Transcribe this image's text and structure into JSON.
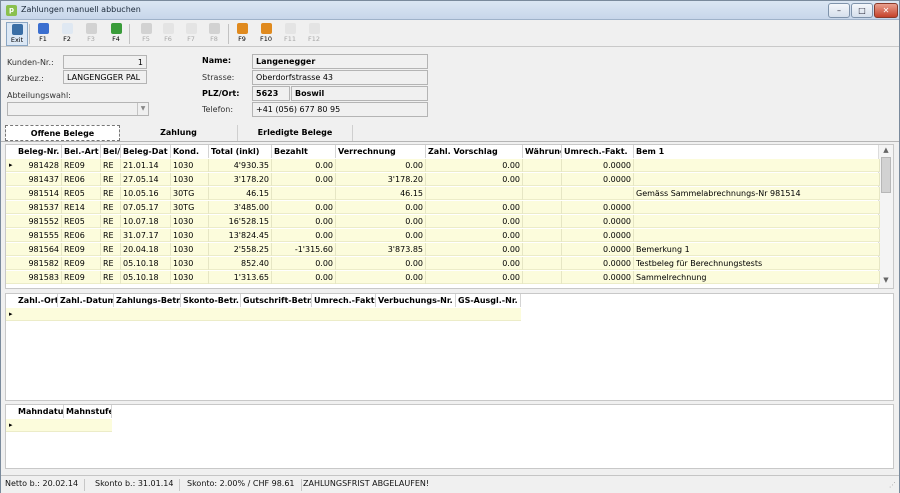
{
  "window": {
    "title": "Zahlungen manuell abbuchen",
    "icon": "app-icon"
  },
  "window_controls": {
    "minimize": "–",
    "maximize": "□",
    "close": "✕"
  },
  "toolbar": [
    {
      "label": "Exit",
      "icon": "exit-icon",
      "color": "#3a6ea5",
      "enabled": true
    },
    {
      "label": "F1",
      "icon": "help-icon",
      "color": "#3b6fd0",
      "enabled": true
    },
    {
      "label": "F2",
      "icon": "new-doc-icon",
      "color": "#dfe8f2",
      "enabled": true
    },
    {
      "label": "F3",
      "icon": "delete-icon",
      "color": "#9a9a9a",
      "enabled": false
    },
    {
      "label": "F4",
      "icon": "flag-icon",
      "color": "#3a9c3a",
      "enabled": true
    },
    {
      "label": "F5",
      "icon": "pin-icon",
      "color": "#9a9a9a",
      "enabled": false
    },
    {
      "label": "F6",
      "icon": "blank-icon",
      "color": "#cfcfcf",
      "enabled": false
    },
    {
      "label": "F7",
      "icon": "blank-icon",
      "color": "#cfcfcf",
      "enabled": false
    },
    {
      "label": "F8",
      "icon": "print-icon",
      "color": "#9a9a9a",
      "enabled": false
    },
    {
      "label": "F9",
      "icon": "wand-icon",
      "color": "#e08a1e",
      "enabled": true
    },
    {
      "label": "F10",
      "icon": "wand-icon",
      "color": "#e08a1e",
      "enabled": true
    },
    {
      "label": "F11",
      "icon": "blank-icon",
      "color": "#cfcfcf",
      "enabled": false
    },
    {
      "label": "F12",
      "icon": "blank-icon",
      "color": "#cfcfcf",
      "enabled": false
    }
  ],
  "customer": {
    "kunden_nr_label": "Kunden-Nr.:",
    "kunden_nr": "1",
    "kurzbez_label": "Kurzbez.:",
    "kurzbez": "LANGENGGER PAL",
    "abteilung_label": "Abteilungswahl:",
    "abteilung": "",
    "name_label": "Name:",
    "name": "Langenegger",
    "strasse_label": "Strasse:",
    "strasse": "Oberdorfstrasse 43",
    "plz_label": "PLZ/Ort:",
    "plz": "5623",
    "ort": "Boswil",
    "telefon_label": "Telefon:",
    "telefon": "+41 (056) 677 80 95"
  },
  "tabs": [
    "Offene Belege",
    "Zahlung",
    "Erledigte Belege"
  ],
  "belege": {
    "columns": [
      "Beleg-Nr.",
      "Bel.-Art",
      "Bel/",
      "Beleg-Dat",
      "Kond.",
      "Total (inkl)",
      "Bezahlt",
      "Verrechnung",
      "Zahl. Vorschlag",
      "Währung",
      "Umrech.-Fakt.",
      "Bem 1"
    ],
    "rows": [
      [
        "981428",
        "RE09",
        "RE",
        "21.01.14",
        "1030",
        "4'930.35",
        "0.00",
        "0.00",
        "0.00",
        "",
        "0.0000",
        ""
      ],
      [
        "981437",
        "RE06",
        "RE",
        "27.05.14",
        "1030",
        "3'178.20",
        "0.00",
        "3'178.20",
        "0.00",
        "",
        "0.0000",
        ""
      ],
      [
        "981514",
        "RE05",
        "RE",
        "10.05.16",
        "30TG",
        "46.15",
        "",
        "46.15",
        "",
        "",
        "",
        "Gemäss Sammelabrechnungs-Nr 981514"
      ],
      [
        "981537",
        "RE14",
        "RE",
        "07.05.17",
        "30TG",
        "3'485.00",
        "0.00",
        "0.00",
        "0.00",
        "",
        "0.0000",
        ""
      ],
      [
        "981552",
        "RE05",
        "RE",
        "10.07.18",
        "1030",
        "16'528.15",
        "0.00",
        "0.00",
        "0.00",
        "",
        "0.0000",
        ""
      ],
      [
        "981555",
        "RE06",
        "RE",
        "31.07.17",
        "1030",
        "13'824.45",
        "0.00",
        "0.00",
        "0.00",
        "",
        "0.0000",
        ""
      ],
      [
        "981564",
        "RE09",
        "RE",
        "20.04.18",
        "1030",
        "2'558.25",
        "-1'315.60",
        "3'873.85",
        "0.00",
        "",
        "0.0000",
        "Bemerkung 1"
      ],
      [
        "981582",
        "RE09",
        "RE",
        "05.10.18",
        "1030",
        "852.40",
        "0.00",
        "0.00",
        "0.00",
        "",
        "0.0000",
        "Testbeleg für Berechnungstests"
      ],
      [
        "981583",
        "RE09",
        "RE",
        "05.10.18",
        "1030",
        "1'313.65",
        "0.00",
        "0.00",
        "0.00",
        "",
        "0.0000",
        "Sammelrechnung"
      ]
    ]
  },
  "zahlungen": {
    "columns": [
      "Zahl.-Ort",
      "Zahl.-Datum",
      "Zahlungs-Betr.",
      "Skonto-Betr.",
      "Gutschrift-Betr.",
      "Umrech.-Fakt.",
      "Verbuchungs-Nr.",
      "GS-Ausgl.-Nr."
    ]
  },
  "mahnungen": {
    "columns": [
      "Mahndatum",
      "Mahnstufe"
    ]
  },
  "status": {
    "netto": "Netto b.: 20.02.14",
    "skonto_bis": "Skonto b.: 31.01.14",
    "skonto": "Skonto: 2.00% / CHF 98.61",
    "frist": "ZAHLUNGSFRIST ABGELAUFEN!"
  }
}
